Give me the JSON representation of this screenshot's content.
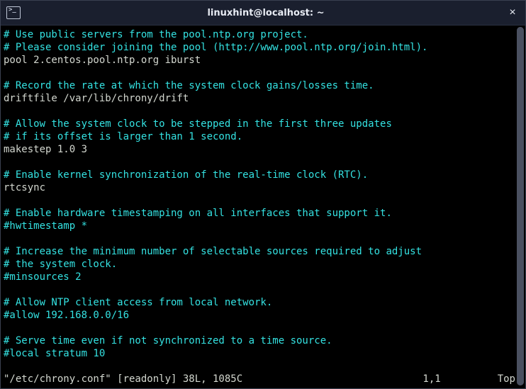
{
  "titlebar": {
    "title": "linuxhint@localhost: ~",
    "close_label": "×"
  },
  "lines": [
    {
      "type": "comment",
      "text": "# Use public servers from the pool.ntp.org project."
    },
    {
      "type": "comment",
      "text": "# Please consider joining the pool (http://www.pool.ntp.org/join.html)."
    },
    {
      "type": "normal",
      "text": "pool 2.centos.pool.ntp.org iburst"
    },
    {
      "type": "normal",
      "text": ""
    },
    {
      "type": "comment",
      "text": "# Record the rate at which the system clock gains/losses time."
    },
    {
      "type": "normal",
      "text": "driftfile /var/lib/chrony/drift"
    },
    {
      "type": "normal",
      "text": ""
    },
    {
      "type": "comment",
      "text": "# Allow the system clock to be stepped in the first three updates"
    },
    {
      "type": "comment",
      "text": "# if its offset is larger than 1 second."
    },
    {
      "type": "normal",
      "text": "makestep 1.0 3"
    },
    {
      "type": "normal",
      "text": ""
    },
    {
      "type": "comment",
      "text": "# Enable kernel synchronization of the real-time clock (RTC)."
    },
    {
      "type": "normal",
      "text": "rtcsync"
    },
    {
      "type": "normal",
      "text": ""
    },
    {
      "type": "comment",
      "text": "# Enable hardware timestamping on all interfaces that support it."
    },
    {
      "type": "comment",
      "text": "#hwtimestamp *"
    },
    {
      "type": "normal",
      "text": ""
    },
    {
      "type": "comment",
      "text": "# Increase the minimum number of selectable sources required to adjust"
    },
    {
      "type": "comment",
      "text": "# the system clock."
    },
    {
      "type": "comment",
      "text": "#minsources 2"
    },
    {
      "type": "normal",
      "text": ""
    },
    {
      "type": "comment",
      "text": "# Allow NTP client access from local network."
    },
    {
      "type": "comment",
      "text": "#allow 192.168.0.0/16"
    },
    {
      "type": "normal",
      "text": ""
    },
    {
      "type": "comment",
      "text": "# Serve time even if not synchronized to a time source."
    },
    {
      "type": "comment",
      "text": "#local stratum 10"
    },
    {
      "type": "normal",
      "text": ""
    }
  ],
  "status": {
    "file": "\"/etc/chrony.conf\" [readonly] 38L, 1085C",
    "position": "1,1",
    "top": "Top"
  }
}
